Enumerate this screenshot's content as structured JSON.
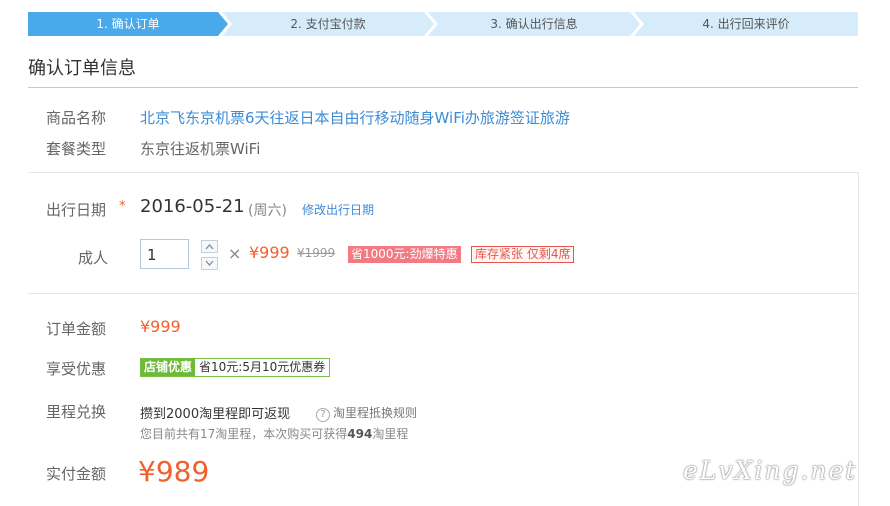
{
  "steps": [
    {
      "label": "1. 确认订单",
      "active": true
    },
    {
      "label": "2. 支付宝付款",
      "active": false
    },
    {
      "label": "3. 确认出行信息",
      "active": false
    },
    {
      "label": "4. 出行回来评价",
      "active": false
    }
  ],
  "colors": {
    "step_active": "#4aa9ea",
    "step_inactive": "#d7ecfb",
    "price_orange": "#f25f2b",
    "link_blue": "#3d8bd4",
    "coupon_green": "#6dba36",
    "badge_red": "#f27a83"
  },
  "page_title": "确认订单信息",
  "product": {
    "name_label": "商品名称",
    "name_value": "北京飞东京机票6天往返日本自由行移动随身WiFi办旅游签证旅游",
    "package_label": "套餐类型",
    "package_value": "东京往返机票WiFi"
  },
  "travel": {
    "date_label": "出行日期",
    "required_mark": "*",
    "date_value": "2016-05-21",
    "weekday": "(周六)",
    "change_link": "修改出行日期",
    "adult_label": "成人",
    "quantity": "1",
    "times": "×",
    "price": "¥999",
    "original_price": "¥1999",
    "discount_badge": "省1000元:劲爆特惠",
    "stock_badge": "库存紧张 仅剩4席",
    "icons": {
      "up": "chevron-up-icon",
      "down": "chevron-down-icon"
    }
  },
  "order": {
    "amount_label": "订单金额",
    "amount_value": "¥999",
    "discount_label": "享受优惠",
    "coupon_tag": "店铺优惠",
    "coupon_text": "省10元:5月10元优惠券",
    "mileage_label": "里程兑换",
    "mileage_value": "攒到2000淘里程即可返现",
    "mileage_rule_link": "淘里程抵换规则",
    "mileage_note_prefix": "您目前共有17淘里程，本次购买可获得",
    "mileage_note_bold": "494",
    "mileage_note_suffix": "淘里程",
    "paid_label": "实付金额",
    "paid_value": "¥989"
  },
  "watermark": "eLvXing.net"
}
